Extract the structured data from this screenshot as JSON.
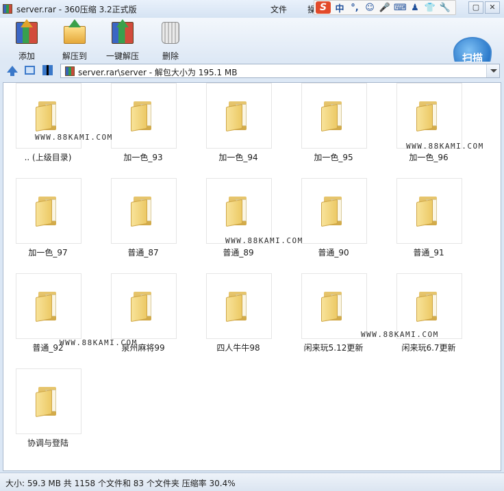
{
  "window": {
    "title": "server.rar - 360压缩 3.2正式版",
    "menu": [
      "文件",
      "操"
    ],
    "controls": [
      "▢",
      "✕"
    ]
  },
  "ime": {
    "logo": "S",
    "mode": "中",
    "punct": "°,",
    "icons": [
      "☺",
      "🎤",
      "⌨",
      "♟",
      "👕",
      "🔧"
    ]
  },
  "toolbar": {
    "buttons": [
      {
        "label": "添加",
        "icon": "add-icon"
      },
      {
        "label": "解压到",
        "icon": "extract-to-icon"
      },
      {
        "label": "一键解压",
        "icon": "one-click-extract-icon"
      },
      {
        "label": "删除",
        "icon": "delete-icon"
      }
    ],
    "scan_label": "扫描"
  },
  "address": {
    "path": "server.rar\\server - 解包大小为 195.1 MB"
  },
  "items": [
    ".. (上级目录)",
    "加一色_93",
    "加一色_94",
    "加一色_95",
    "加一色_96",
    "加一色_97",
    "普通_87",
    "普通_89",
    "普通_90",
    "普通_91",
    "普通_92",
    "泉州麻将99",
    "四人牛牛98",
    "闲来玩5.12更新",
    "闲来玩6.7更新",
    "协调与登陆"
  ],
  "watermark": "WWW.88KAMI.COM",
  "status": "大小: 59.3 MB 共 1158 个文件和 83 个文件夹 压缩率 30.4%"
}
